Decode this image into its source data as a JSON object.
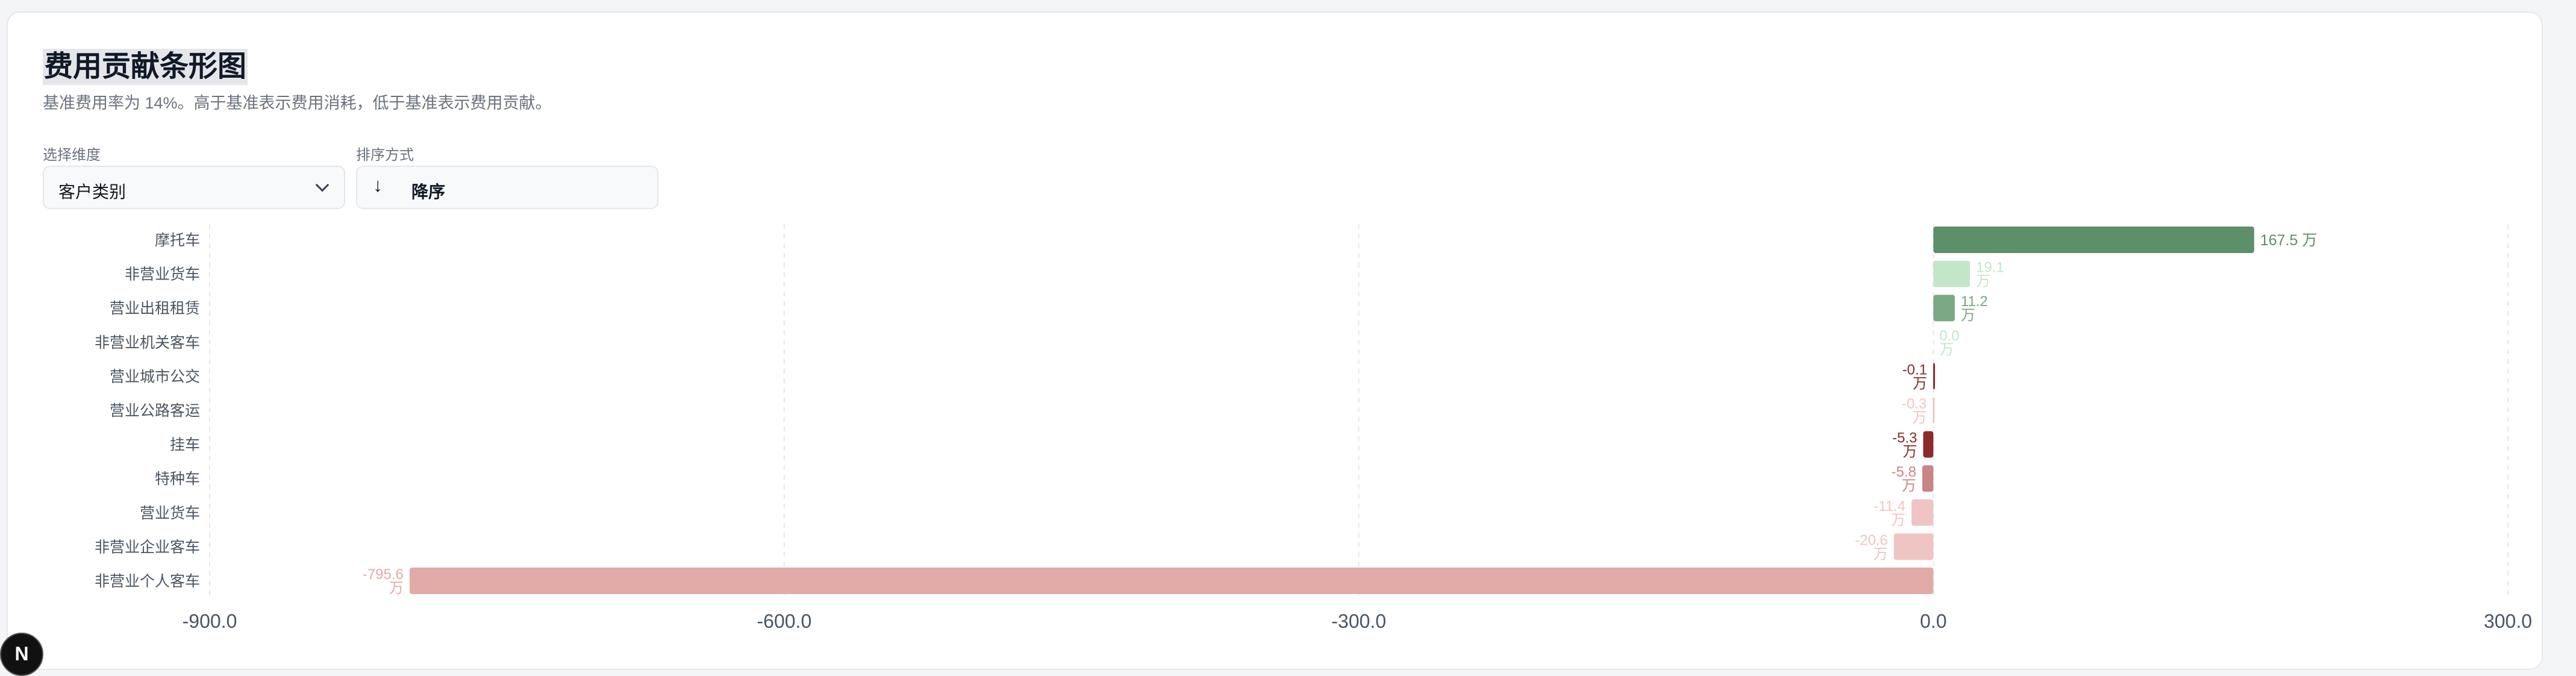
{
  "header": {
    "title": "费用贡献条形图",
    "subtitle": "基准费用率为 14%。高于基准表示费用消耗，低于基准表示费用贡献。"
  },
  "controls": {
    "dimension_label": "选择维度",
    "dimension_value": "客户类别",
    "sort_label": "排序方式",
    "sort_value": "降序",
    "sort_icon": "arrow-down-icon"
  },
  "badge": {
    "letter": "N"
  },
  "colors": {
    "pos_strong": "#5b9068",
    "pos_mid": "#7aa884",
    "pos_light": "#c3e6cb",
    "neg_strong": "#8a2a2a",
    "neg_mid": "#c98585",
    "neg_light": "#f1c4c4",
    "neg_base": "#e2aaa6"
  },
  "chart_data": {
    "type": "bar",
    "orientation": "horizontal",
    "unit": "万",
    "categories": [
      "摩托车",
      "非营业货车",
      "营业出租租赁",
      "非营业机关客车",
      "营业城市公交",
      "营业公路客运",
      "挂车",
      "特种车",
      "营业货车",
      "非营业企业客车",
      "非营业个人客车"
    ],
    "values": [
      167.5,
      19.1,
      11.2,
      0.0,
      -0.1,
      -0.3,
      -5.3,
      -5.8,
      -11.4,
      -20.6,
      -795.6
    ],
    "value_labels": [
      "167.5 万",
      "19.1 万",
      "11.2 万",
      "0.0 万",
      "-0.1 万",
      "-0.3 万",
      "-5.3 万",
      "-5.8 万",
      "-11.4 万",
      "-20.6 万",
      "-795.6 万"
    ],
    "bar_colors": [
      "pos_strong",
      "pos_light",
      "pos_mid",
      "pos_light",
      "neg_strong",
      "neg_light",
      "neg_strong",
      "neg_mid",
      "neg_light",
      "neg_light",
      "neg_base"
    ],
    "xlim": [
      -900,
      300
    ],
    "xticks": [
      "-900.0",
      "-600.0",
      "-300.0",
      "0.0",
      "300.0"
    ],
    "grid": true
  }
}
